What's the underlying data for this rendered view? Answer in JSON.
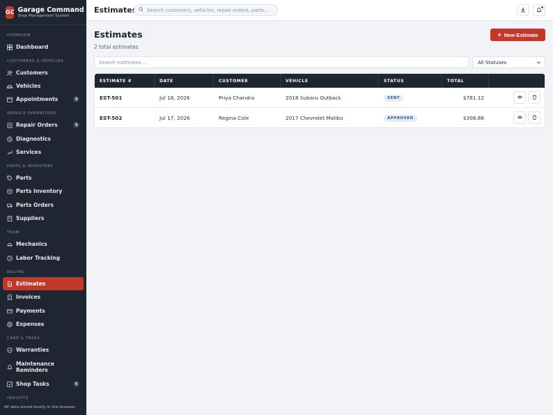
{
  "brand": {
    "logo_text": "GC",
    "name": "Garage Command",
    "subtitle": "Shop Management System"
  },
  "sidebar": {
    "sections": {
      "overview": "Overview",
      "customers_vehicles": "Customers & Vehicles",
      "service_operations": "Service Operations",
      "parts_inventory": "Parts & Inventory",
      "team": "Team",
      "billing": "Billing",
      "care_tasks": "Care & Tasks",
      "insights": "Insights"
    },
    "items": [
      {
        "label": "Dashboard",
        "icon": "grid-icon"
      },
      {
        "label": "Customers",
        "icon": "users-icon"
      },
      {
        "label": "Vehicles",
        "icon": "car-icon"
      },
      {
        "label": "Appointments",
        "icon": "calendar-icon",
        "badge": "3"
      },
      {
        "label": "Repair Orders",
        "icon": "clipboard-icon",
        "badge": "3"
      },
      {
        "label": "Diagnostics",
        "icon": "pulse-icon"
      },
      {
        "label": "Services",
        "icon": "wrench-icon"
      },
      {
        "label": "Parts",
        "icon": "tag-icon"
      },
      {
        "label": "Parts Inventory",
        "icon": "box-icon"
      },
      {
        "label": "Parts Orders",
        "icon": "truck-icon"
      },
      {
        "label": "Suppliers",
        "icon": "building-icon"
      },
      {
        "label": "Mechanics",
        "icon": "hardhat-icon"
      },
      {
        "label": "Labor Tracking",
        "icon": "clock-icon"
      },
      {
        "label": "Estimates",
        "icon": "document-icon",
        "active": true
      },
      {
        "label": "Invoices",
        "icon": "receipt-icon"
      },
      {
        "label": "Payments",
        "icon": "card-icon"
      },
      {
        "label": "Expenses",
        "icon": "coin-icon"
      },
      {
        "label": "Warranties",
        "icon": "shield-icon"
      },
      {
        "label": "Maintenance Reminders",
        "icon": "bell-icon"
      },
      {
        "label": "Shop Tasks",
        "icon": "checkbox-icon",
        "badge": "5"
      }
    ],
    "footnote": "All data stored locally in this browser."
  },
  "topbar": {
    "title": "Estimates",
    "search_placeholder": "Search customers, vehicles, repair orders, parts...",
    "download_icon": "download-icon",
    "notifications_icon": "bell-icon"
  },
  "main": {
    "title": "Estimates",
    "subtitle": "2 total estimates",
    "new_button": "New Estimate",
    "filter_placeholder": "Search estimates...",
    "status_filter": "All Statuses",
    "columns": [
      "Estimate #",
      "Date",
      "Customer",
      "Vehicle",
      "Status",
      "Total",
      ""
    ],
    "rows": [
      {
        "number": "EST-501",
        "date": "Jul 18, 2026",
        "customer": "Priya Chandra",
        "vehicle": "2018 Subaru Outback",
        "status": "SENT",
        "total": "$781.12"
      },
      {
        "number": "EST-502",
        "date": "Jul 17, 2026",
        "customer": "Regina Cole",
        "vehicle": "2017 Chevrolet Malibu",
        "status": "APPROVED",
        "total": "$308.88"
      }
    ]
  },
  "colors": {
    "accent": "#c0392b",
    "sidebar_bg": "#1f2632",
    "sent_pill_bg": "#e3ecf7",
    "sent_pill_fg": "#2c5a8a",
    "approved_pill_bg": "#e3ecf7",
    "approved_pill_fg": "#2c5a8a"
  }
}
